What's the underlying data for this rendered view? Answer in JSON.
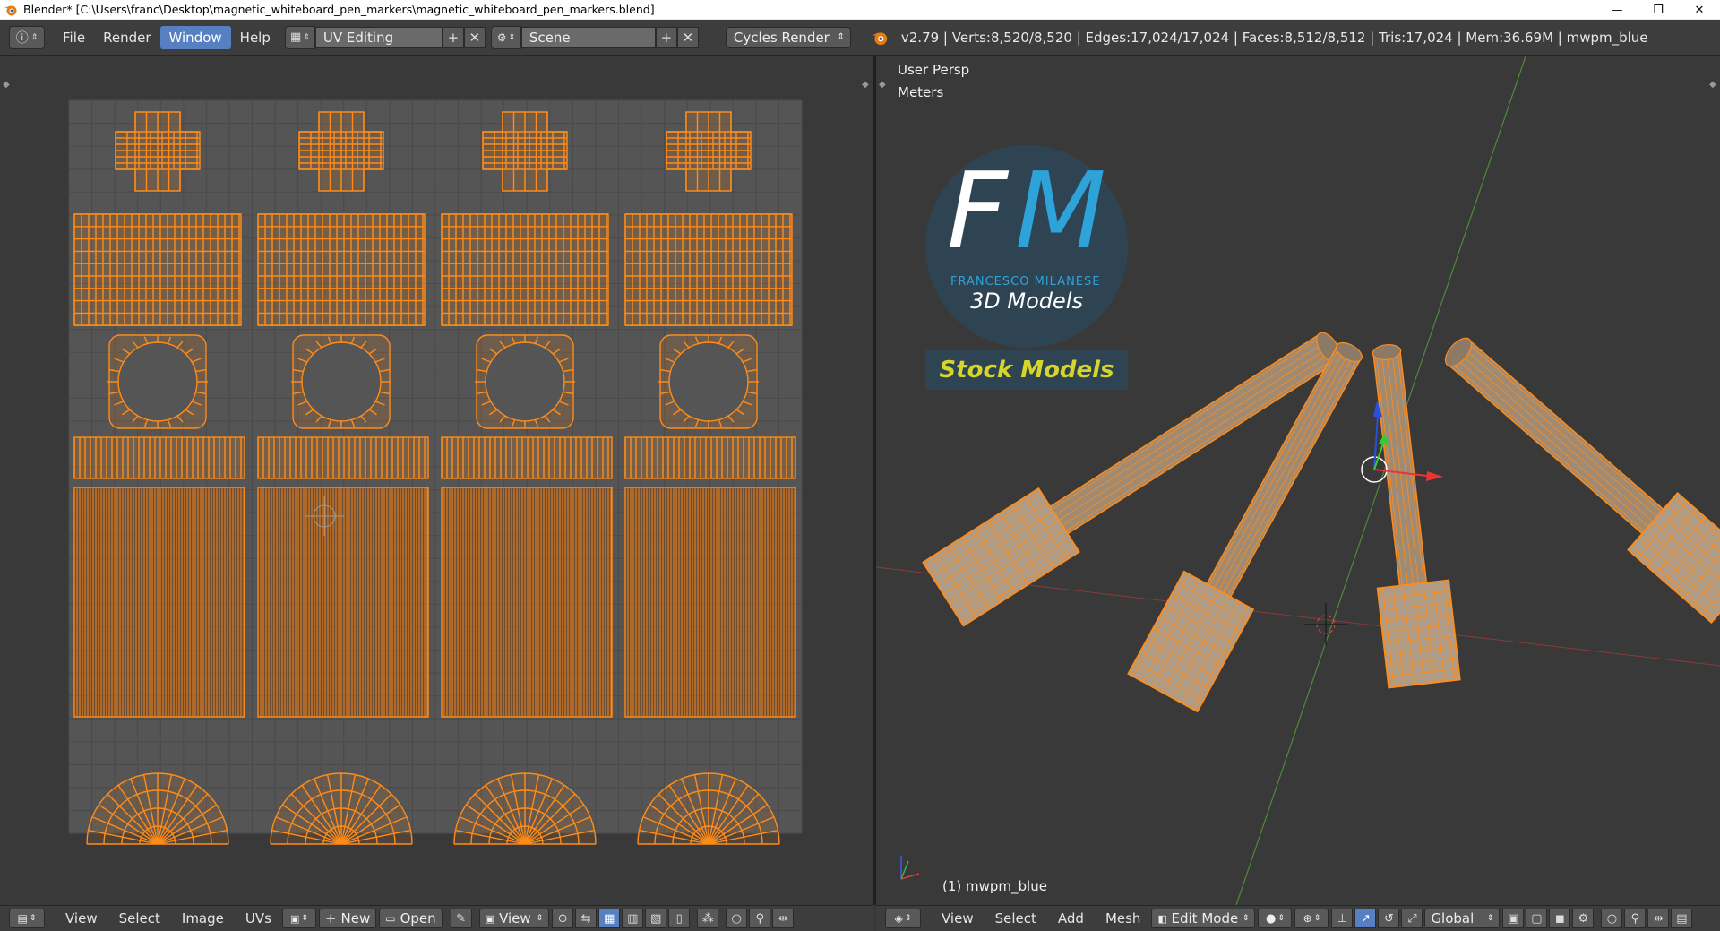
{
  "window": {
    "title": "Blender* [C:\\Users\\franc\\Desktop\\magnetic_whiteboard_pen_markers\\magnetic_whiteboard_pen_markers.blend]",
    "minimize": "—",
    "restore": "❐",
    "close": "✕"
  },
  "info_header": {
    "menus": [
      "File",
      "Render",
      "Window",
      "Help"
    ],
    "active_menu": "Window",
    "screen_layout": "UV Editing",
    "scene": "Scene",
    "render_engine": "Cycles Render",
    "stats": "v2.79 | Verts:8,520/8,520 | Edges:17,024/17,024 | Faces:8,512/8,512 | Tris:17,024 | Mem:36.69M | mwpm_blue"
  },
  "viewport": {
    "view_name": "User Persp",
    "units": "Meters",
    "object_label": "(1) mwpm_blue",
    "logo": {
      "letters_f": "F",
      "letters_m": "M",
      "brand": "FRANCESCO MILANESE",
      "tagline": "3D Models",
      "badge": "Stock Models"
    }
  },
  "uv_footer": {
    "menus": [
      "View",
      "Select",
      "Image",
      "UVs"
    ],
    "new_label": "New",
    "open_label": "Open",
    "view_label": "View"
  },
  "viewport_footer": {
    "menus": [
      "View",
      "Select",
      "Add",
      "Mesh"
    ],
    "mode": "Edit Mode",
    "orientation": "Global"
  },
  "colors": {
    "accent": "#5680c2",
    "wire": "#ff8c1a",
    "background": "#393939",
    "uv_bg": "#555555"
  }
}
